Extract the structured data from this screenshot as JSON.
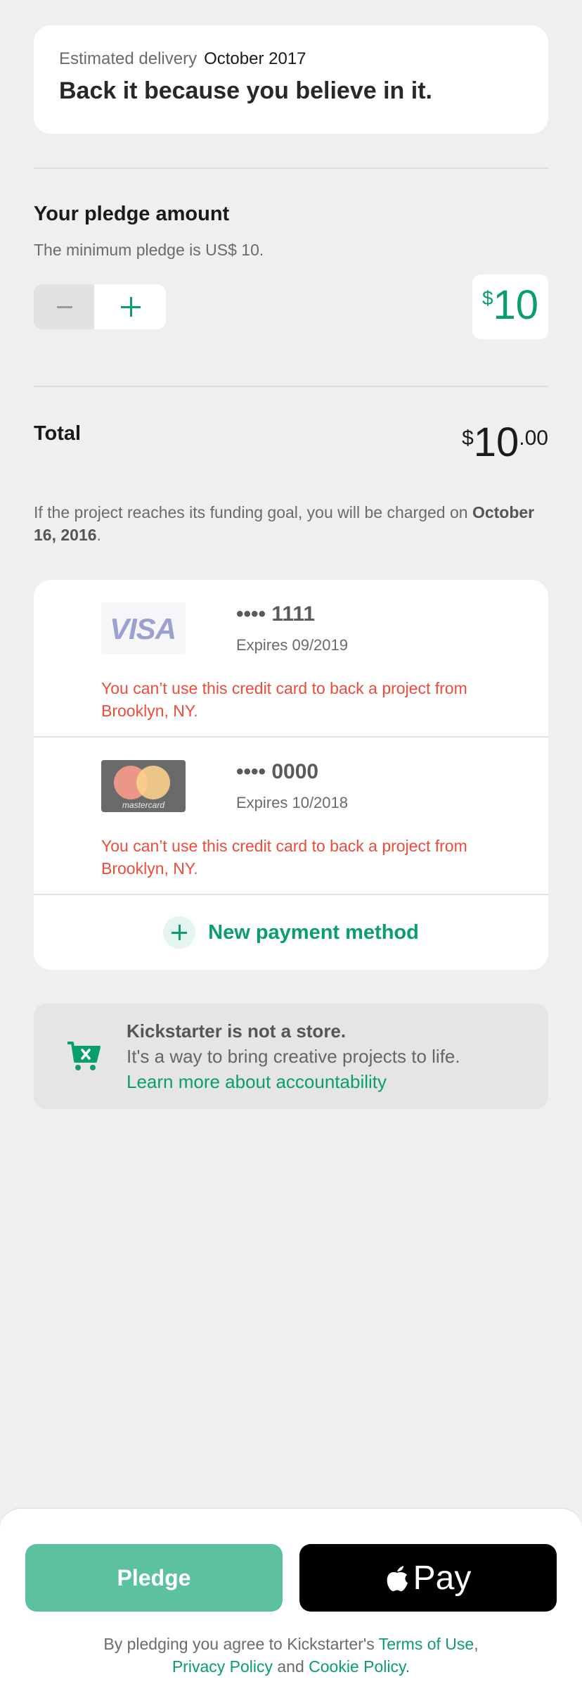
{
  "delivery": {
    "label": "Estimated delivery",
    "date": "October 2017",
    "tagline": "Back it because you believe in it."
  },
  "pledge": {
    "title": "Your pledge amount",
    "minimum_text": "The minimum pledge is US$ 10.",
    "currency_symbol": "$",
    "amount": "10"
  },
  "total": {
    "label": "Total",
    "currency_symbol": "$",
    "whole": "10",
    "cents": ".00"
  },
  "charge_notice": {
    "text": "If the project reaches its funding goal, you will be charged on",
    "date": "October 16, 2016",
    "end": "."
  },
  "payment_methods": [
    {
      "brand": "VISA",
      "number": "•••• 1111",
      "expires": "Expires 09/2019",
      "error": "You can’t use this credit card to back a project from Brooklyn, NY."
    },
    {
      "brand": "mastercard",
      "number": "•••• 0000",
      "expires": "Expires 10/2018",
      "error": "You can’t use this credit card to back a project from Brooklyn, NY."
    }
  ],
  "new_payment_label": "New payment method",
  "store_notice": {
    "title": "Kickstarter is not a store.",
    "subtitle": "It's a way to bring creative projects to life.",
    "link": "Learn more about accountability"
  },
  "actions": {
    "pledge_label": "Pledge",
    "apple_pay_label": "Pay"
  },
  "legal": {
    "prefix": "By pledging you agree to Kickstarter's",
    "terms": "Terms of Use",
    "comma": ",",
    "privacy": "Privacy Policy",
    "and": "and",
    "cookie": "Cookie Policy",
    "end": "."
  },
  "colors": {
    "accent": "#0a9d6e",
    "error": "#ee4b3a",
    "pledge_button": "#5cc1a0"
  }
}
